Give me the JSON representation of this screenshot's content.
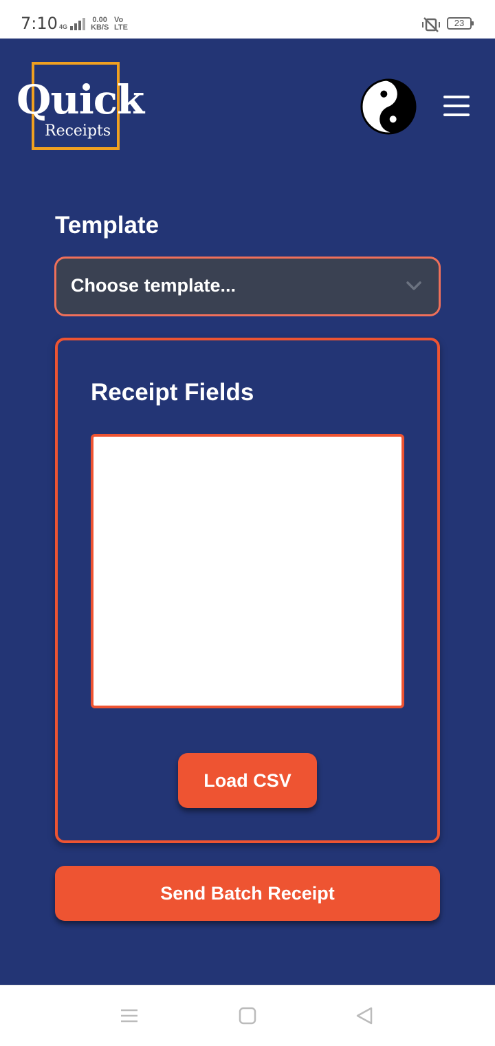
{
  "status_bar": {
    "time": "7:10",
    "network": "4G",
    "speed_value": "0.00",
    "speed_unit": "KB/S",
    "volte_top": "Vo",
    "volte_bottom": "LTE",
    "battery": "23"
  },
  "header": {
    "logo_top": "Quick",
    "logo_bottom": "Receipts",
    "theme_toggle_icon": "yin-yang-icon",
    "menu_icon": "hamburger-menu-icon"
  },
  "template": {
    "label": "Template",
    "select_value": "Choose template..."
  },
  "receipt_fields": {
    "title": "Receipt Fields",
    "value": "",
    "load_button": "Load CSV"
  },
  "actions": {
    "send_button": "Send Batch Receipt"
  },
  "nav_bar": {
    "icons": [
      "recents-icon",
      "home-icon",
      "back-icon"
    ]
  },
  "colors": {
    "background": "#233575",
    "accent": "#ee5432",
    "select_bg": "#3a4152",
    "logo_border": "#f0a020"
  }
}
